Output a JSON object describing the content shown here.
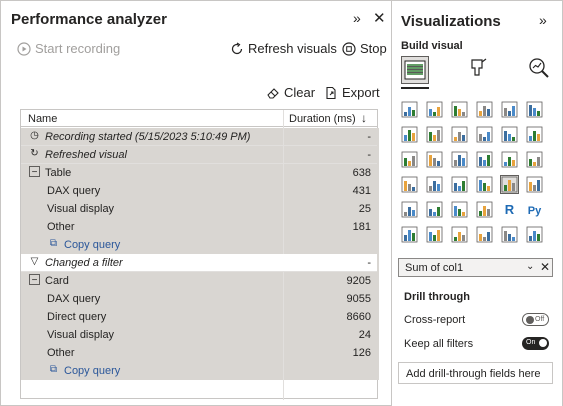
{
  "perf": {
    "title": "Performance analyzer",
    "start_recording": "Start recording",
    "refresh_visuals": "Refresh visuals",
    "stop": "Stop",
    "clear": "Clear",
    "export": "Export",
    "columns": {
      "name": "Name",
      "duration": "Duration (ms)"
    },
    "rows": [
      {
        "name": "Recording started (5/15/2023 5:10:49 PM)",
        "duration": "-"
      },
      {
        "name": "Refreshed visual",
        "duration": "-"
      },
      {
        "name": "Table",
        "duration": "638"
      },
      {
        "name": "DAX query",
        "duration": "431"
      },
      {
        "name": "Visual display",
        "duration": "25"
      },
      {
        "name": "Other",
        "duration": "181"
      },
      {
        "name": "Copy query",
        "duration": ""
      },
      {
        "name": "Changed a filter",
        "duration": "-"
      },
      {
        "name": "Card",
        "duration": "9205"
      },
      {
        "name": "DAX query",
        "duration": "9055"
      },
      {
        "name": "Direct query",
        "duration": "8660"
      },
      {
        "name": "Visual display",
        "duration": "24"
      },
      {
        "name": "Other",
        "duration": "126"
      },
      {
        "name": "Copy query",
        "duration": ""
      }
    ]
  },
  "viz": {
    "title": "Visualizations",
    "build_visual": "Build visual",
    "field": "Sum of col1",
    "drill_through": "Drill through",
    "cross_report": "Cross-report",
    "cross_report_state": "Off",
    "keep_all_filters": "Keep all filters",
    "keep_all_filters_state": "On",
    "add_drill": "Add drill-through fields here",
    "icons": [
      "stacked-bar-icon",
      "stacked-column-icon",
      "clustered-bar-icon",
      "clustered-column-icon",
      "100-stacked-bar-icon",
      "100-stacked-column-icon",
      "line-chart-icon",
      "area-chart-icon",
      "stacked-area-icon",
      "line-column-icon",
      "line-clustered-column-icon",
      "ribbon-chart-icon",
      "waterfall-icon",
      "funnel-icon",
      "scatter-icon",
      "pie-icon",
      "donut-icon",
      "treemap-icon",
      "map-icon",
      "filled-map-icon",
      "azure-map-icon",
      "gauge-icon",
      "card-icon",
      "multi-row-card-icon",
      "kpi-icon",
      "slicer-icon",
      "table-icon",
      "matrix-icon",
      "r-visual-icon",
      "python-visual-icon",
      "key-influencers-icon",
      "decomposition-tree-icon",
      "qa-icon",
      "smart-narrative-icon",
      "goals-icon",
      "paginated-report-icon"
    ],
    "icon_glyphs": [
      "",
      "",
      "",
      "",
      "",
      "",
      "",
      "",
      "",
      "",
      "",
      "",
      "",
      "",
      "",
      "",
      "",
      "",
      "",
      "",
      "",
      "",
      "",
      "",
      "",
      "",
      "",
      "",
      "R",
      "Py",
      "",
      "",
      "",
      "",
      "",
      ""
    ]
  }
}
